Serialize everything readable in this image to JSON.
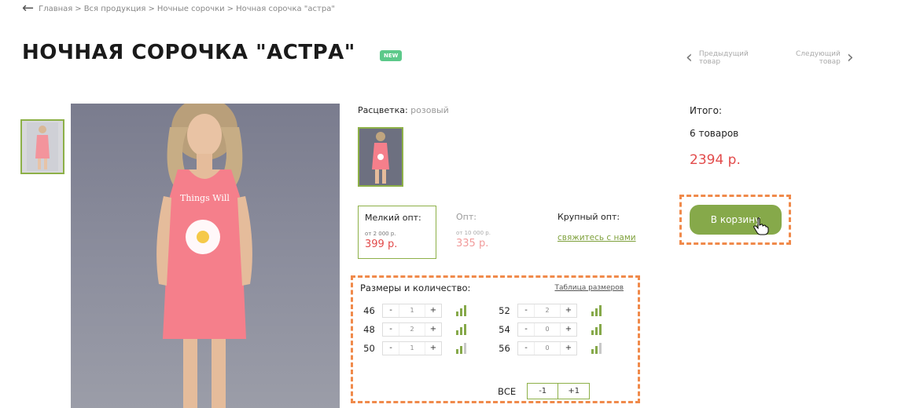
{
  "breadcrumb": {
    "items": [
      "Главная",
      "Вся продукция",
      "Ночные сорочки",
      "Ночная сорочка \"астра\""
    ],
    "separator": ">"
  },
  "product": {
    "title": "НОЧНАЯ СОРОЧКА \"АСТРА\"",
    "badge": "NEW"
  },
  "navigation": {
    "prev_line1": "Предыдущий",
    "prev_line2": "товар",
    "next_line1": "Следующий",
    "next_line2": "товар"
  },
  "color": {
    "label": "Расцветка:",
    "value": "розовый"
  },
  "prices": [
    {
      "label": "Мелкий опт:",
      "min": "от 2 000 р.",
      "price": "399 р."
    },
    {
      "label": "Опт:",
      "min": "от 10 000 р.",
      "price": "335 р."
    },
    {
      "label": "Крупный опт:",
      "link": "свяжитесь с нами"
    }
  ],
  "sizes": {
    "title": "Размеры и количество:",
    "table_link": "Таблица размеров",
    "rows": [
      {
        "size": "46",
        "qty": "1",
        "stock_level": 3
      },
      {
        "size": "48",
        "qty": "2",
        "stock_level": 3
      },
      {
        "size": "50",
        "qty": "1",
        "stock_level": 2
      },
      {
        "size": "52",
        "qty": "2",
        "stock_level": 3
      },
      {
        "size": "54",
        "qty": "0",
        "stock_level": 3
      },
      {
        "size": "56",
        "qty": "0",
        "stock_level": 2
      }
    ],
    "minus": "-",
    "plus": "+",
    "all_label": "ВСЕ",
    "all_minus": "-1",
    "all_plus": "+1"
  },
  "summary": {
    "label": "Итого:",
    "count": "6 товаров",
    "total": "2394 р.",
    "cart_button": "В корзину"
  },
  "colors": {
    "accent_green": "#86a94a",
    "price_red": "#e24b4b",
    "highlight_orange": "#f08a4b",
    "badge_green": "#5cc98a"
  }
}
